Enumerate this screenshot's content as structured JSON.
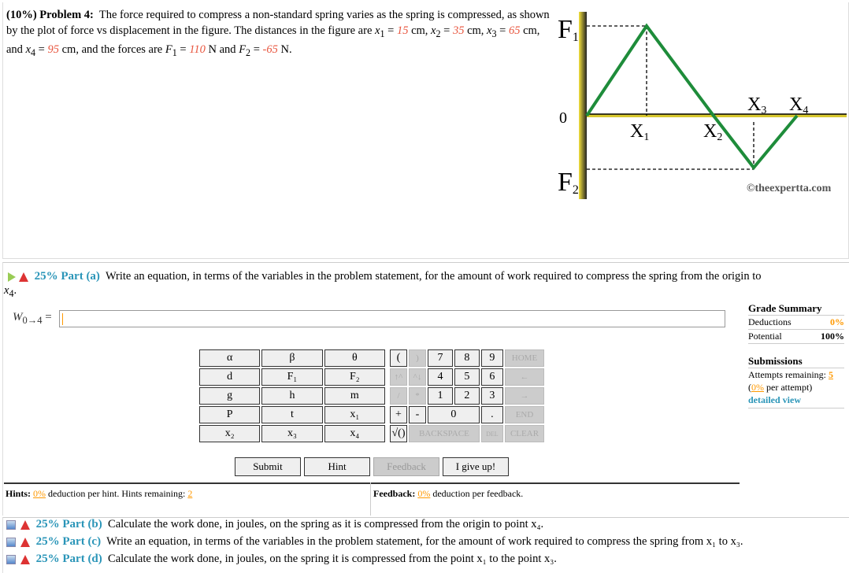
{
  "problem": {
    "weight": "(10%)",
    "label": "Problem 4:",
    "text1": "The force required to compress a non-standard spring varies as the spring is compressed, as shown by the plot of force vs displacement in the figure. The distances in the figure are ",
    "x1": "15",
    "x2": "35",
    "x3": "65",
    "x4": "95",
    "F1": "110",
    "F2": "-65",
    "unit_cm": "cm",
    "unit_N": "N"
  },
  "figure": {
    "labels": {
      "F1": "F",
      "F1sub": "1",
      "F2": "F",
      "F2sub": "2",
      "zero": "0",
      "X1": "X",
      "X1sub": "1",
      "X2": "X",
      "X2sub": "2",
      "X3": "X",
      "X3sub": "3",
      "X4": "X",
      "X4sub": "4"
    },
    "copyright": "©theexpertta.com",
    "line_color": "#1e8c3a"
  },
  "part_a": {
    "title": "25% Part (a)",
    "text": "Write an equation, in terms of the variables in the problem statement, for the amount of work required to compress the spring from the origin to",
    "var": "x",
    "sub": "4",
    "eq_label": "W",
    "eq_sub": "0→4",
    "input_value": ""
  },
  "keypad": {
    "vars": [
      [
        "α",
        "β",
        "θ"
      ],
      [
        "d",
        "F₁",
        "F₂"
      ],
      [
        "g",
        "h",
        "m"
      ],
      [
        "P",
        "t",
        "x₁"
      ],
      [
        "x₂",
        "x₃",
        "x₄"
      ]
    ],
    "keys": {
      "lparen": "(",
      "rparen": ")",
      "k7": "7",
      "k8": "8",
      "k9": "9",
      "home": "HOME",
      "up": "↑^",
      "down": "^↓",
      "k4": "4",
      "k5": "5",
      "k6": "6",
      "left": "←",
      "div": "/",
      "mul": "*",
      "k1": "1",
      "k2": "2",
      "k3": "3",
      "right": "→",
      "plus": "+",
      "minus": "-",
      "k0": "0",
      "dot": ".",
      "end": "END",
      "sqrt": "√()",
      "backspace": "BACKSPACE",
      "del": "DEL",
      "clear": "CLEAR"
    }
  },
  "buttons": {
    "submit": "Submit",
    "hint": "Hint",
    "feedback": "Feedback",
    "giveup": "I give up!"
  },
  "hints": {
    "label": "Hints:",
    "pct": "0%",
    "text": "deduction per hint. Hints remaining:",
    "remaining": "2"
  },
  "feedback": {
    "label": "Feedback:",
    "pct": "0%",
    "text": "deduction per feedback."
  },
  "grade": {
    "title": "Grade Summary",
    "deductions_label": "Deductions",
    "deductions": "0%",
    "potential_label": "Potential",
    "potential": "100%",
    "submissions_title": "Submissions",
    "attempts_label": "Attempts remaining:",
    "attempts": "5",
    "per_attempt_pct": "0%",
    "per_attempt": "per attempt)",
    "detailed": "detailed view"
  },
  "parts": [
    {
      "title": "25% Part (b)",
      "text": "Calculate the work done, in joules, on the spring as it is compressed from the origin to point x₄."
    },
    {
      "title": "25% Part (c)",
      "text": "Write an equation, in terms of the variables in the problem statement, for the amount of work required to compress the spring from x₁ to x₃."
    },
    {
      "title": "25% Part (d)",
      "text": "Calculate the work done, in joules, on the spring it is compressed from the point x₁ to the point x₃."
    }
  ]
}
